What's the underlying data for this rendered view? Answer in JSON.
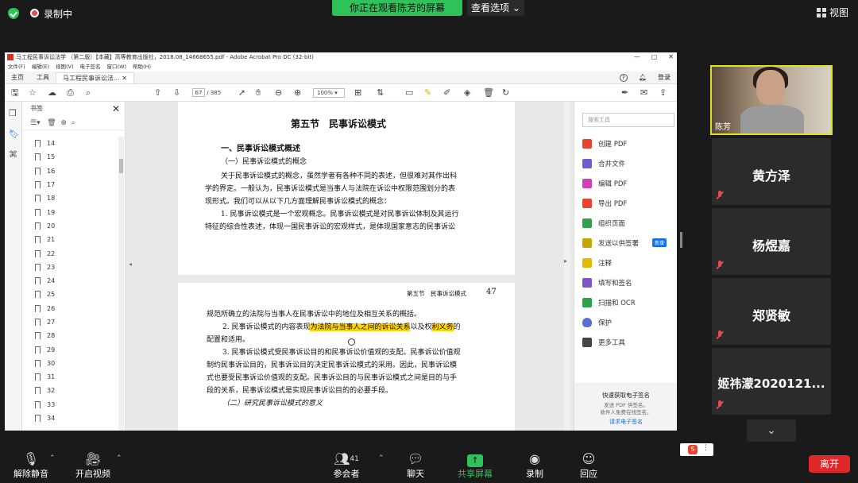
{
  "zoom": {
    "recording_label": "录制中",
    "banner_text": "你正在观看陈芳的屏幕",
    "view_options_label": "查看选项",
    "view_label": "视图",
    "leave_label": "离开",
    "participants_count": "41",
    "bottom": {
      "mute": "解除静音",
      "video": "开启视频",
      "participants": "参会者",
      "chat": "聊天",
      "share": "共享屏幕",
      "record": "录制",
      "reactions": "回应"
    }
  },
  "participants": {
    "video_name": "陈芳",
    "tiles": [
      "黄方泽",
      "杨煜嘉",
      "郑贤敏",
      "姬祎濛2020121..."
    ]
  },
  "acrobat": {
    "window_title": "马工程民事诉讼法学 （第二版）【本藏】高等教育出版社，2018.08_14668655.pdf - Adobe Acrobat Pro DC (32-bit)",
    "menus": [
      "文件(F)",
      "编辑(E)",
      "视图(V)",
      "电子签名",
      "窗口(W)",
      "帮助(H)"
    ],
    "tabs": [
      "主页",
      "工具",
      "马工程民事诉讼法..."
    ],
    "signin_label": "登录",
    "current_page": "67",
    "total_pages": "/ 385",
    "zoom_level": "100%",
    "bookmarks_title": "书签",
    "bookmarks": [
      "14",
      "15",
      "16",
      "17",
      "18",
      "19",
      "20",
      "21",
      "22",
      "23",
      "24",
      "25",
      "26",
      "27",
      "28",
      "29",
      "30",
      "31",
      "32",
      "33",
      "34"
    ],
    "tools_search_placeholder": "搜索工具",
    "tools": [
      "创建 PDF",
      "合并文件",
      "编辑 PDF",
      "导出 PDF",
      "组织页面",
      "发送以供签署",
      "注释",
      "填写和签名",
      "扫描和 OCR",
      "保护",
      "更多工具"
    ],
    "tool_new_badge": "新增",
    "tool_colors": [
      "#e8432e",
      "#6b5fd3",
      "#d13fbd",
      "#e8432e",
      "#2fa24b",
      "#c8a400",
      "#e6b800",
      "#7d55c7",
      "#2fa24b",
      "#5a6fd3",
      "#444444"
    ],
    "esign_title": "快速获取电子签名",
    "esign_desc1": "发送 PDF 供签名。",
    "esign_desc2": "收件人免费在线签名。",
    "esign_link": "请求电子签名"
  },
  "document": {
    "section_title": "第五节　民事诉讼模式",
    "h1": "一、民事诉讼模式概述",
    "h2": "（一）民事诉讼模式的概念",
    "p1_l1": "关于民事诉讼模式的概念，虽然学者有各种不同的表述，但很难对其作出科",
    "p1_l2": "学的界定。一般认为，民事诉讼模式是当事人与法院在诉讼中权限范围划分的表",
    "p1_l3": "现形式。我们可以从以下几方面理解民事诉讼模式的概念：",
    "p2_l1": "1. 民事诉讼模式是一个宏观概念。民事诉讼模式是对民事诉讼体制及其运行",
    "p2_l2": "特征的综合性表述，体现一国民事诉讼的宏观样式，是体现国家意志的民事诉讼",
    "running_head": "第五节　民事诉讼模式",
    "page_number": "47",
    "q1": "规范所确立的法院与当事人在民事诉讼中的地位及相互关系的概括。",
    "q2_pre": "2. 民事诉讼模式的内容表现",
    "q2_hl1": "为法院与当事人之间的诉讼关系",
    "q2_mid": "以及权",
    "q2_hl2": "利义务",
    "q2_post": "的",
    "q3": "配置和适用。",
    "q4": "3. 民事诉讼模式受民事诉讼目的和民事诉讼价值观的支配。民事诉讼价值观",
    "q5": "制约民事诉讼目的，民事诉讼目的决定民事诉讼模式的采用。因此，民事诉讼模",
    "q6": "式也要受民事诉讼价值观的支配。民事诉讼目的与民事诉讼模式之间是目的与手",
    "q7": "段的关系，民事诉讼模式是实现民事诉讼目的的必要手段。",
    "q8": "（二）研究民事诉讼模式的意义"
  }
}
